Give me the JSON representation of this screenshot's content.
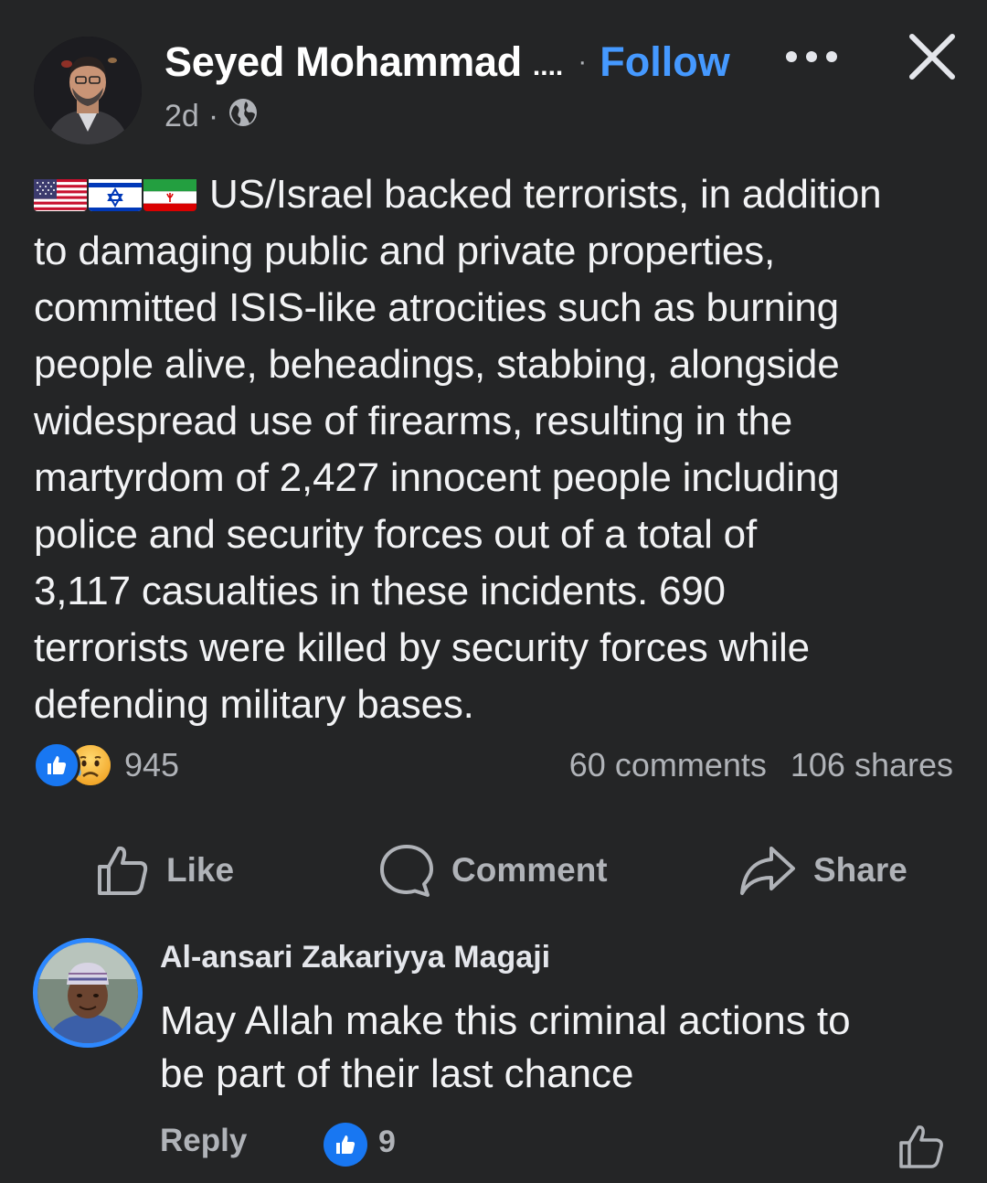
{
  "post": {
    "author_name": "Seyed Mohammad",
    "name_ellipsis": "....",
    "separator": "·",
    "follow_label": "Follow",
    "time": "2d",
    "meta_separator": "·",
    "audience_icon": "globe-icon",
    "more_icon": "more-dots-icon",
    "close_icon": "close-icon",
    "flags": [
      "us-flag",
      "israel-flag",
      "iran-flag"
    ],
    "lines": [
      "US/Israel backed terrorists, in addition",
      "to damaging public and private properties,",
      "committed ISIS-like atrocities such as burning",
      "people alive, beheadings, stabbing, alongside",
      "widespread use of firearms, resulting in the",
      "martyrdom of 2,427 innocent people including",
      "police and security forces out of a total of",
      "3,117 casualties in these incidents. 690",
      "terrorists were killed by security forces while",
      "defending military bases."
    ]
  },
  "stats": {
    "reaction_count": "945",
    "comments": "60 comments",
    "shares": "106 shares"
  },
  "actions": {
    "like": "Like",
    "comment": "Comment",
    "share": "Share"
  },
  "comment": {
    "author": "Al-ansari Zakariyya Magaji",
    "lines": [
      "May Allah make this criminal actions to",
      "be part of their last chance"
    ],
    "reply_label": "Reply",
    "like_count": "9"
  },
  "colors": {
    "background": "#242526",
    "accent": "#4599ff",
    "like_blue": "#1877f2",
    "muted_text": "#b0b3b8"
  }
}
